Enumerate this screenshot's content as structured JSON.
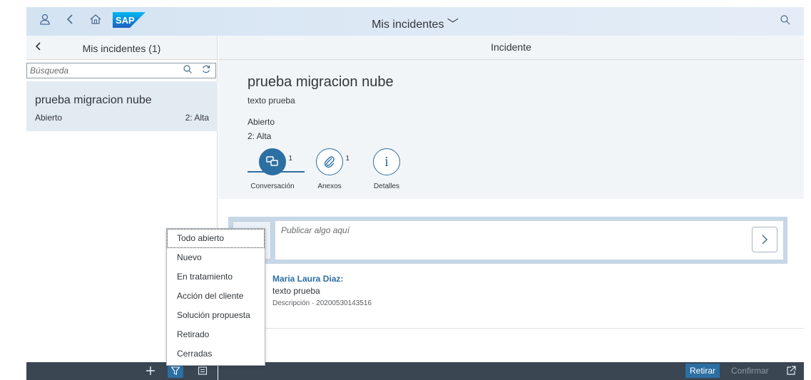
{
  "shell": {
    "title": "Mis incidentes",
    "icons": [
      "user-icon",
      "back-icon",
      "home-icon",
      "search-icon"
    ],
    "logo_text": "SAP"
  },
  "master": {
    "title": "Mis incidentes (1)",
    "search_placeholder": "Búsqueda",
    "items": [
      {
        "title": "prueba migracion nube",
        "status": "Abierto",
        "priority": "2: Alta"
      }
    ]
  },
  "detail": {
    "header_title": "Incidente",
    "object_title": "prueba migracion nube",
    "object_subtitle": "texto prueba",
    "status": "Abierto",
    "priority": "2: Alta",
    "tabs": [
      {
        "label": "Conversación",
        "count": "1",
        "icon": "conversation-icon"
      },
      {
        "label": "Anexos",
        "count": "1",
        "icon": "attachment-icon"
      },
      {
        "label": "Detalles",
        "count": "",
        "icon": "info-icon"
      }
    ],
    "feed_placeholder": "Publicar algo aquí",
    "post": {
      "author": "Maria Laura Diaz:",
      "text": "texto prueba",
      "meta": "Descripción · 20200530143516"
    }
  },
  "footer": {
    "retirar": "Retirar",
    "confirmar": "Confirmar"
  },
  "menu": {
    "items": [
      "Todo abierto",
      "Nuevo",
      "En tratamiento",
      "Acción del cliente",
      "Solución propuesta",
      "Retirado",
      "Cerradas"
    ]
  },
  "colors": {
    "accent": "#2c6fa3",
    "shell_bg": "#d4e3f2",
    "footer_bg": "#3a4652"
  }
}
